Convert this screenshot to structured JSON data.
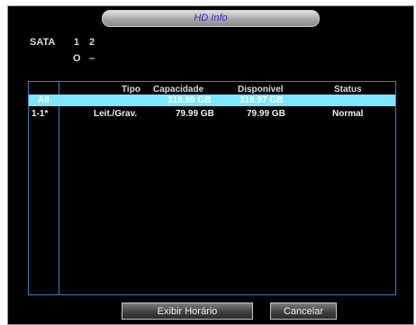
{
  "dialog": {
    "title": "HD Info"
  },
  "hd_status": {
    "label": "SATA",
    "ports": [
      "1",
      "2"
    ],
    "states": [
      "O",
      "–"
    ]
  },
  "table": {
    "columns": [
      "Tipo",
      "Capacidade",
      "Disponível",
      "Status"
    ],
    "rows": [
      {
        "id": "All",
        "tipo": "",
        "capacidade": "319.99 GB",
        "disponivel": "319.97 GB",
        "status": ""
      },
      {
        "id": "1-1*",
        "tipo": "Leit./Grav.",
        "capacidade": "79.99 GB",
        "disponivel": "79.99 GB",
        "status": "Normal"
      }
    ],
    "selected_row": 0
  },
  "buttons": {
    "show_time": "Exibir Horário",
    "cancel": "Cancelar"
  }
}
